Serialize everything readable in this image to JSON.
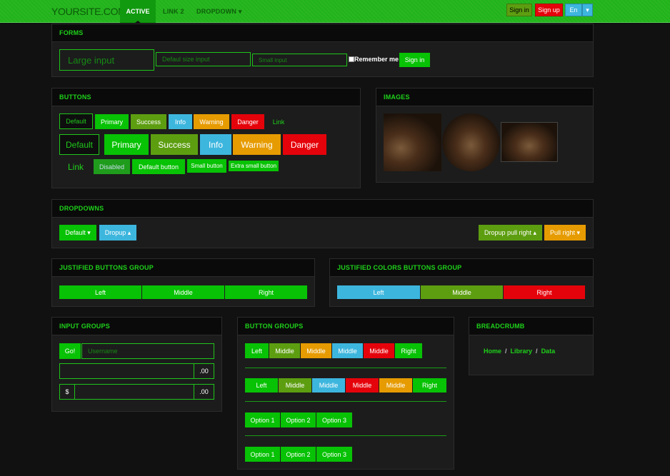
{
  "navbar": {
    "brand": "YOURSITE.COM",
    "active": "ACTIVE",
    "link2": "LINK 2",
    "dropdown": "DROPDOWN",
    "sign_in": "Sign in",
    "sign_up": "Sign up",
    "lang": "En"
  },
  "forms": {
    "title": "FORMS",
    "large_placeholder": "Large input",
    "default_placeholder": "Defaul size input",
    "small_placeholder": "Small input",
    "remember": "Remember me",
    "sign_in": "Sign in"
  },
  "buttons": {
    "title": "BUTTONS",
    "row1": [
      "Default",
      "Primary",
      "Success",
      "Info",
      "Warning",
      "Danger",
      "Link"
    ],
    "row2": [
      "Default",
      "Primary",
      "Success",
      "Info",
      "Warning",
      "Danger"
    ],
    "row3": [
      "Link",
      "Disabled",
      "Default button",
      "Small button",
      "Extra small button"
    ]
  },
  "images": {
    "title": "IMAGES"
  },
  "dropdowns": {
    "title": "DROPDOWNS",
    "default": "Default",
    "dropup": "Dropup",
    "dropup_right": "Dropup pull right",
    "pull_right": "Pull right"
  },
  "justified": {
    "title": "JUSTIFIED BUTTONS GROUP",
    "labels": [
      "Left",
      "Middle",
      "Right"
    ]
  },
  "justified_colors": {
    "title": "JUSTIFIED COLORS BUTTONS GROUP",
    "labels": [
      "Left",
      "Middle",
      "Right"
    ]
  },
  "input_groups": {
    "title": "INPUT GROUPS",
    "go": "Go!",
    "username_placeholder": "Username",
    "suffix1": ".00",
    "prefix2": "$",
    "suffix2": ".00"
  },
  "button_groups": {
    "title": "BUTTON GROUPS",
    "row1": [
      "Left",
      "Middle",
      "Middle",
      "Middle",
      "Middle",
      "Right"
    ],
    "row2": [
      "Left",
      "Middle",
      "Middle",
      "Middle",
      "Middle",
      "Right"
    ],
    "row3": [
      "Option 1",
      "Option 2",
      "Option 3"
    ],
    "row4": [
      "Option 1",
      "Option 2",
      "Option 3"
    ]
  },
  "breadcrumb": {
    "title": "BREADCRUMB",
    "items": [
      "Home",
      "Library",
      "Data"
    ],
    "sep": "/"
  },
  "colors": {
    "primary": "#08c205",
    "success": "#5d9e11",
    "info": "#3db6de",
    "warning": "#e69b00",
    "danger": "#e5030b"
  }
}
